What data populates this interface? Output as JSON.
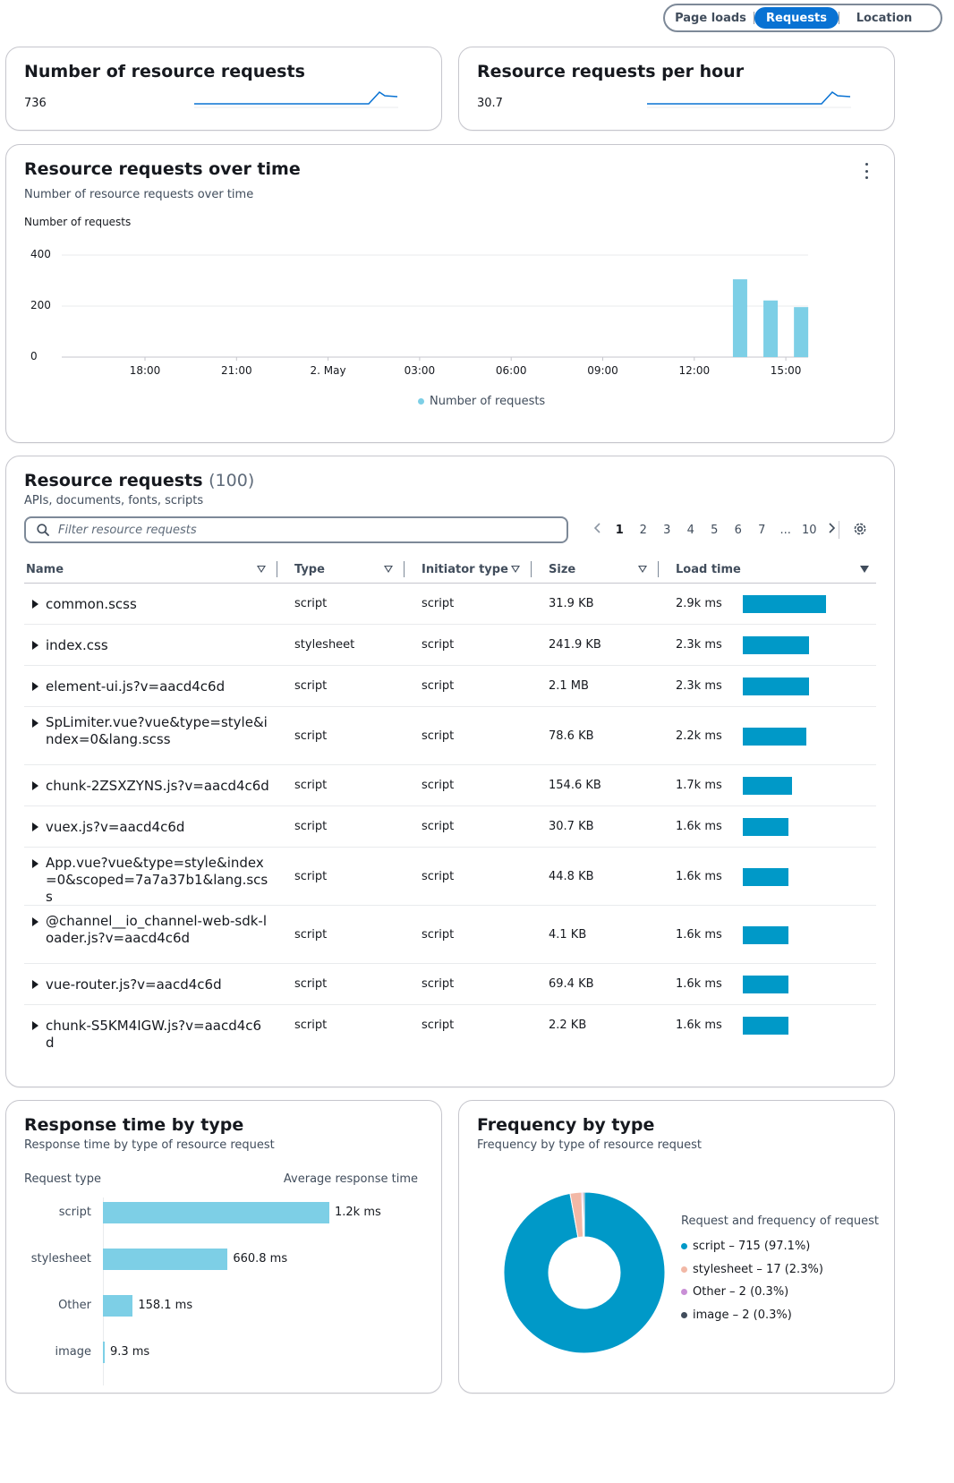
{
  "segments": [
    "Page loads",
    "Requests",
    "Location"
  ],
  "kpis": [
    {
      "title": "Number of resource requests",
      "value": "736"
    },
    {
      "title": "Resource requests per hour",
      "value": "30.7"
    }
  ],
  "time_chart": {
    "title": "Resource requests over time",
    "description": "Number of resource requests over time",
    "chart_data": {
      "type": "bar",
      "ylabel": "Number of requests",
      "ylim": [
        0,
        400
      ],
      "yticks": [
        "400",
        "200",
        "0"
      ],
      "xticks": [
        "18:00",
        "21:00",
        "2. May",
        "03:00",
        "06:00",
        "09:00",
        "12:00",
        "15:00"
      ],
      "series": [
        {
          "name": "Number of requests",
          "points": [
            {
              "x": "13:30",
              "y": 305
            },
            {
              "x": "14:30",
              "y": 222
            },
            {
              "x": "15:30",
              "y": 196
            }
          ]
        }
      ],
      "legend": "bottom-center",
      "grid": true
    },
    "legend_label": "Number of requests",
    "color": "#7dcfe6"
  },
  "resources": {
    "title": "Resource requests",
    "count": "(100)",
    "description": "APIs, documents, fonts, scripts",
    "filter_placeholder": "Filter resource requests",
    "pages": [
      "1",
      "2",
      "3",
      "4",
      "5",
      "6",
      "7",
      "...",
      "10"
    ],
    "columns": [
      "Name",
      "Type",
      "Initiator type",
      "Size",
      "Load time"
    ],
    "rows": [
      {
        "name": "common.scss",
        "type": "script",
        "initiator": "script",
        "size": "31.9 KB",
        "load": "2.9k ms",
        "load_ms": 2900
      },
      {
        "name": "index.css",
        "type": "stylesheet",
        "initiator": "script",
        "size": "241.9 KB",
        "load": "2.3k ms",
        "load_ms": 2300
      },
      {
        "name": "element-ui.js?v=aacd4c6d",
        "type": "script",
        "initiator": "script",
        "size": "2.1 MB",
        "load": "2.3k ms",
        "load_ms": 2300
      },
      {
        "name": "SpLimiter.vue?vue&type=style&index=0&lang.scss",
        "type": "script",
        "initiator": "script",
        "size": "78.6 KB",
        "load": "2.2k ms",
        "load_ms": 2200
      },
      {
        "name": "chunk-2ZSXZYNS.js?v=aacd4c6d",
        "type": "script",
        "initiator": "script",
        "size": "154.6 KB",
        "load": "1.7k ms",
        "load_ms": 1700
      },
      {
        "name": "vuex.js?v=aacd4c6d",
        "type": "script",
        "initiator": "script",
        "size": "30.7 KB",
        "load": "1.6k ms",
        "load_ms": 1600
      },
      {
        "name": "App.vue?vue&type=style&index=0&scoped=7a7a37b1&lang.scss",
        "type": "script",
        "initiator": "script",
        "size": "44.8 KB",
        "load": "1.6k ms",
        "load_ms": 1600
      },
      {
        "name": "@channel__io_channel-web-sdk-loader.js?v=aacd4c6d",
        "type": "script",
        "initiator": "script",
        "size": "4.1 KB",
        "load": "1.6k ms",
        "load_ms": 1600
      },
      {
        "name": "vue-router.js?v=aacd4c6d",
        "type": "script",
        "initiator": "script",
        "size": "69.4 KB",
        "load": "1.6k ms",
        "load_ms": 1600
      },
      {
        "name": "chunk-S5KM4IGW.js?v=aacd4c6d",
        "type": "script",
        "initiator": "script",
        "size": "2.2 KB",
        "load": "1.6k ms",
        "load_ms": 1600
      }
    ],
    "bar_color": "#0099c8"
  },
  "response_time": {
    "title": "Response time by type",
    "description": "Response time by type of resource request",
    "chart_data": {
      "type": "bar",
      "orientation": "horizontal",
      "xlabel": "Average response time",
      "ylabel": "Request type",
      "categories": [
        "script",
        "stylesheet",
        "Other",
        "image"
      ],
      "values": [
        1200,
        660.8,
        158.1,
        9.3
      ],
      "labels": [
        "1.2k ms",
        "660.8 ms",
        "158.1 ms",
        "9.3 ms"
      ]
    },
    "color": "#7dcfe6"
  },
  "frequency": {
    "title": "Frequency by type",
    "description": "Frequency by type of resource request",
    "legend_title": "Request and frequency of request",
    "chart_data": {
      "type": "pie",
      "donut": true,
      "slices": [
        {
          "name": "script",
          "value": 715,
          "label": "script – 715 (97.1%)",
          "color": "#0099c8"
        },
        {
          "name": "stylesheet",
          "value": 17,
          "label": "stylesheet – 17 (2.3%)",
          "color": "#f2b8a6"
        },
        {
          "name": "Other",
          "value": 2,
          "label": "Other – 2 (0.3%)",
          "color": "#c98fd6"
        },
        {
          "name": "image",
          "value": 2,
          "label": "image – 2 (0.3%)",
          "color": "#414d5c"
        }
      ],
      "legend": "right"
    }
  }
}
